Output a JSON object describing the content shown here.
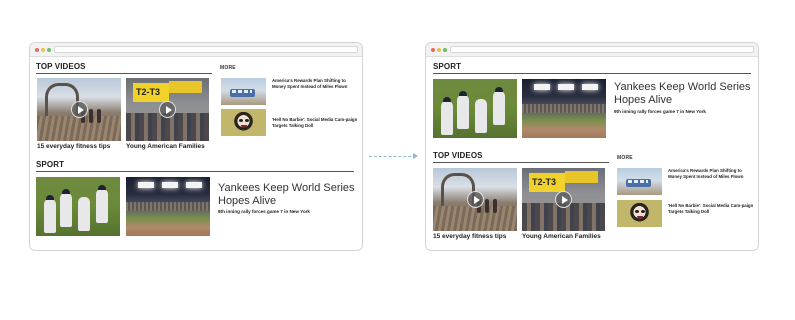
{
  "left_window": {
    "top_videos": {
      "title": "TOP VIDEOS",
      "more_label": "MORE",
      "videos": [
        {
          "caption": "15 everyday fitness tips",
          "image": "brooklyn-bridge-runners-photo"
        },
        {
          "caption": "Young American Families",
          "image": "t2-t3-street-crowd-photo",
          "sign_text": "T2-T3"
        }
      ],
      "side_items": [
        {
          "title": "America's Rewards Plan Shifting to Money Spent Instead of Miles Flown",
          "image": "train-photo"
        },
        {
          "title": "'Hell No Barbie': Social Media Cam-paign Targets Talking Doll",
          "image": "woman-face-photo"
        }
      ]
    },
    "sport": {
      "title": "SPORT",
      "headline": "Yankees Keep World Series Hopes Alive",
      "subhead": "9th inning rally forces game 7 in New York",
      "images": [
        "baseball-players-photo",
        "stadium-night-photo"
      ]
    }
  },
  "right_window": {
    "sport": {
      "title": "SPORT",
      "headline": "Yankees Keep World Series Hopes Alive",
      "subhead": "9th inning rally forces game 7 in New York",
      "images": [
        "baseball-players-photo",
        "stadium-night-photo"
      ]
    },
    "top_videos": {
      "title": "TOP VIDEOS",
      "more_label": "MORE",
      "videos": [
        {
          "caption": "15 everyday fitness tips",
          "image": "brooklyn-bridge-runners-photo"
        },
        {
          "caption": "Young American Families",
          "image": "t2-t3-street-crowd-photo",
          "sign_text": "T2-T3"
        }
      ],
      "side_items": [
        {
          "title": "America's Rewards Plan Shifting to Money Spent Instead of Miles Flown",
          "image": "train-photo"
        },
        {
          "title": "'Hell No Barbie': Social Media Cam-paign Targets Talking Doll",
          "image": "woman-face-photo"
        }
      ]
    }
  },
  "colors": {
    "rule": "#555555",
    "arrow": "#8fb8d8",
    "window_border": "#d4d4d4"
  }
}
